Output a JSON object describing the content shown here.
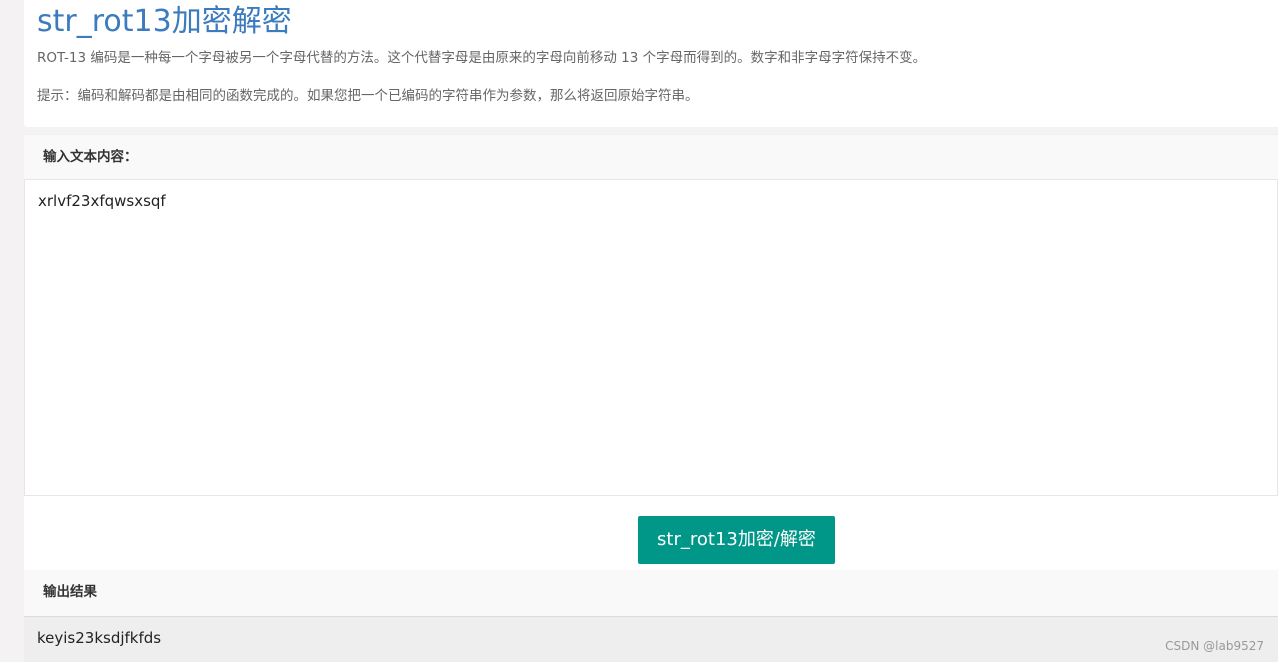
{
  "header": {
    "title": "str_rot13加密解密",
    "description": "ROT-13 编码是一种每一个字母被另一个字母代替的方法。这个代替字母是由原来的字母向前移动 13 个字母而得到的。数字和非字母字符保持不变。",
    "hint": "提示：编码和解码都是由相同的函数完成的。如果您把一个已编码的字符串作为参数，那么将返回原始字符串。"
  },
  "input": {
    "label": "输入文本内容：",
    "value": "xrlvf23xfqwsxsqf"
  },
  "action": {
    "button_label": "str_rot13加密/解密"
  },
  "output": {
    "label": "输出结果",
    "value": "keyis23ksdjfkfds"
  },
  "watermark": "CSDN @lab9527",
  "colors": {
    "title": "#3b7bbf",
    "button": "#009688"
  }
}
